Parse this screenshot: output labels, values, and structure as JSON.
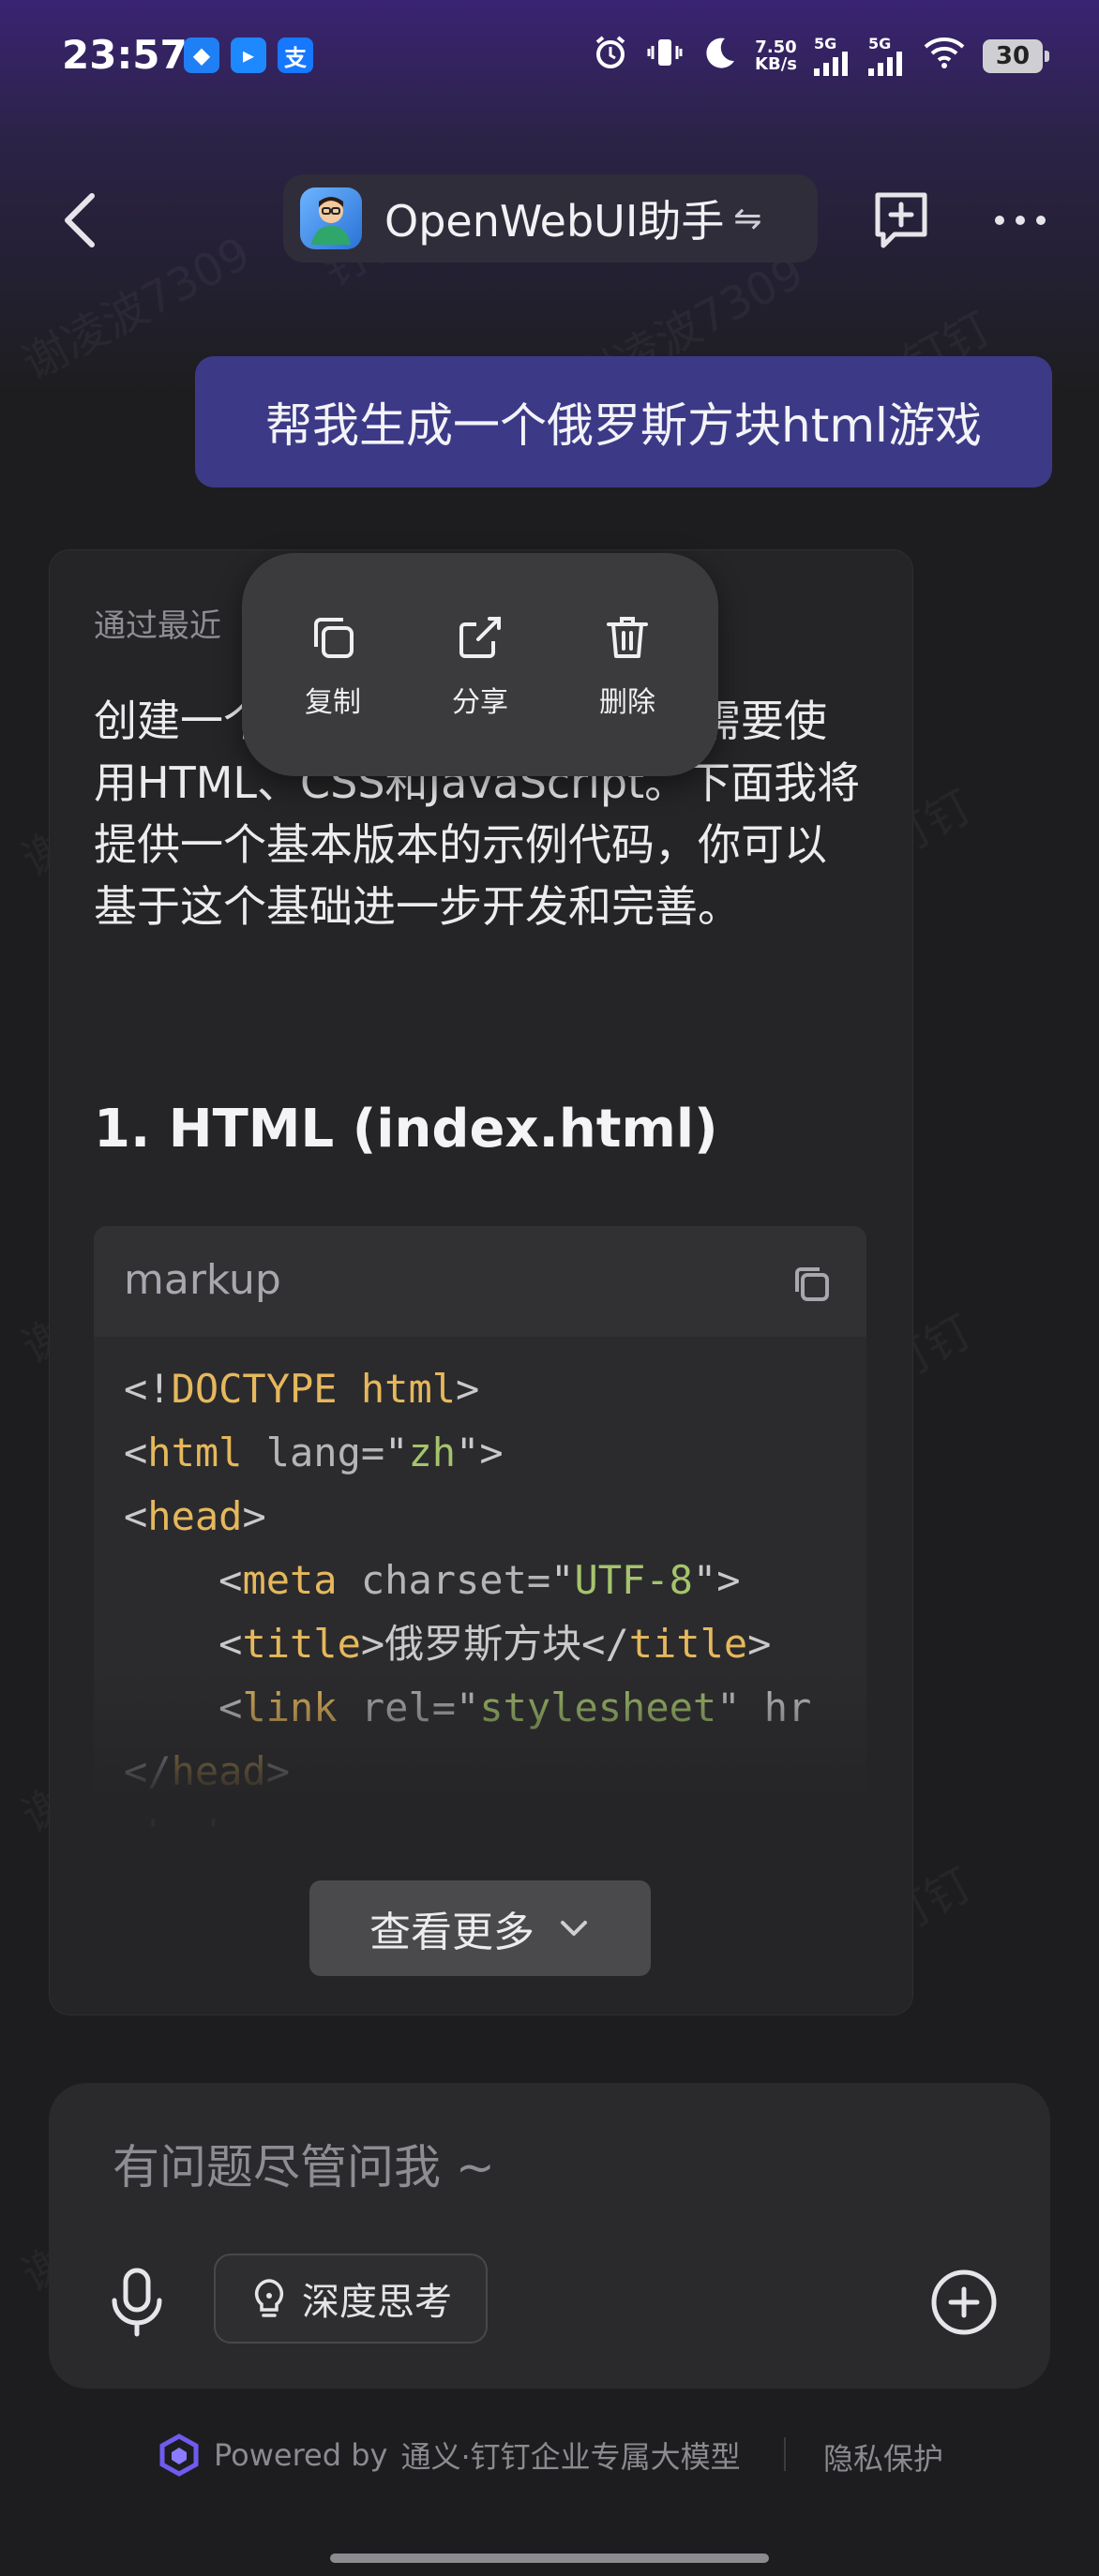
{
  "status_bar": {
    "time": "23:57",
    "app_badges": [
      "◆",
      "▸",
      "支"
    ],
    "net_speed_value": "7.50",
    "net_speed_unit": "KB/s",
    "signal_1": "5G",
    "signal_2": "5G",
    "battery": "30"
  },
  "header": {
    "assistant_name": "OpenWebUI助手",
    "swap_glyph": "⇋"
  },
  "user_message": "帮我生成一个俄罗斯方块html游戏",
  "answer": {
    "meta_text": "通过最近",
    "body": "创建一个完整的俄罗斯方块游戏需要使用HTML、CSS和JavaScript。下面我将提供一个基本版本的示例代码，你可以基于这个基础进一步开发和完善。",
    "heading": "1. HTML (index.html)",
    "code": {
      "language": "markup",
      "lines": [
        [
          [
            "punct",
            "<!"
          ],
          [
            "tag",
            "DOCTYPE html"
          ],
          [
            "punct",
            ">"
          ]
        ],
        [
          [
            "punct",
            "<"
          ],
          [
            "tag",
            "html"
          ],
          [
            "attr",
            " lang="
          ],
          [
            "punct",
            "\""
          ],
          [
            "str",
            "zh"
          ],
          [
            "punct",
            "\">"
          ]
        ],
        [
          [
            "punct",
            "<"
          ],
          [
            "tag",
            "head"
          ],
          [
            "punct",
            ">"
          ]
        ],
        [
          [
            "punct",
            "    <"
          ],
          [
            "tag",
            "meta"
          ],
          [
            "attr",
            " charset="
          ],
          [
            "punct",
            "\""
          ],
          [
            "str",
            "UTF-8"
          ],
          [
            "punct",
            "\">"
          ]
        ],
        [
          [
            "punct",
            "    <"
          ],
          [
            "tag",
            "title"
          ],
          [
            "punct",
            ">俄罗斯方块</"
          ],
          [
            "tag",
            "title"
          ],
          [
            "punct",
            ">"
          ]
        ],
        [
          [
            "punct",
            "    <"
          ],
          [
            "tag",
            "link"
          ],
          [
            "attr",
            " rel="
          ],
          [
            "punct",
            "\""
          ],
          [
            "str",
            "stylesheet"
          ],
          [
            "punct",
            "\" hr"
          ]
        ],
        [
          [
            "punct",
            "</"
          ],
          [
            "tag",
            "head"
          ],
          [
            "punct",
            ">"
          ]
        ],
        [
          [
            "punct",
            "<"
          ],
          [
            "tag",
            "body"
          ],
          [
            "punct",
            ">"
          ]
        ]
      ]
    },
    "show_more_label": "查看更多"
  },
  "context_menu": {
    "copy_label": "复制",
    "share_label": "分享",
    "delete_label": "删除"
  },
  "input": {
    "placeholder": "有问题尽管问我 ~",
    "deep_think_label": "深度思考"
  },
  "footer": {
    "powered_prefix": "Powered by",
    "powered_name": "通义·钉钉企业专属大模型",
    "privacy_label": "隐私保护"
  },
  "watermark_text": "谢凌波7309",
  "watermark_text_2": "钉钉",
  "colors": {
    "user_bubble": "#3c3a86",
    "accent_logo": "#6f5bf0"
  }
}
